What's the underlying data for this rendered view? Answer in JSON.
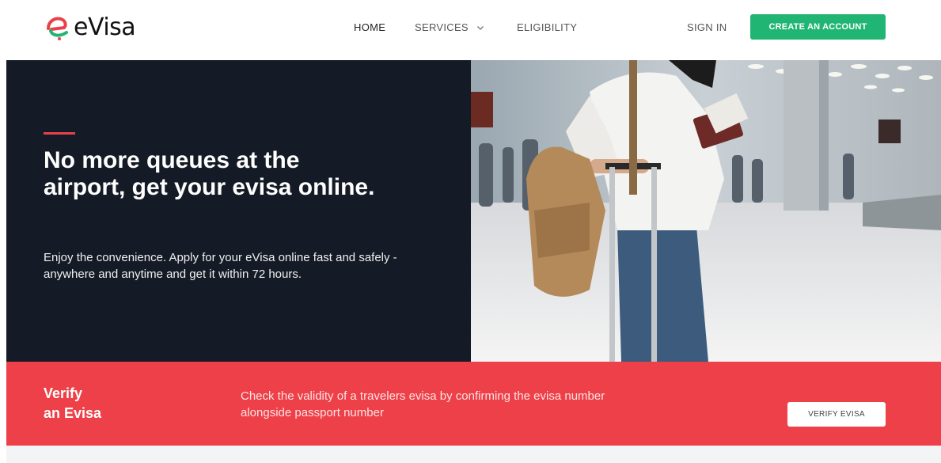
{
  "header": {
    "logo_text": "eVisa",
    "nav": {
      "home": "HOME",
      "services": "SERVICES",
      "eligibility": "ELIGIBILITY",
      "sign_in": "SIGN IN",
      "create_account": "CREATE AN ACCOUNT"
    }
  },
  "hero": {
    "title": "No more queues at the airport, get your evisa online.",
    "subtitle": "Enjoy the convenience. Apply for your eVisa online fast and safely - anywhere and anytime and get it within 72 hours."
  },
  "verify": {
    "title_line1": "Verify",
    "title_line2": "an Evisa",
    "description": "Check the validity of a travelers evisa by confirming the evisa number alongside passport number",
    "button": "VERIFY EVISA"
  },
  "colors": {
    "accent_green": "#21b573",
    "accent_red": "#ee4048",
    "hero_dark": "#151b26"
  },
  "icons": {
    "logo": "evisa-logo-icon",
    "services_dropdown": "chevron-down-icon"
  }
}
